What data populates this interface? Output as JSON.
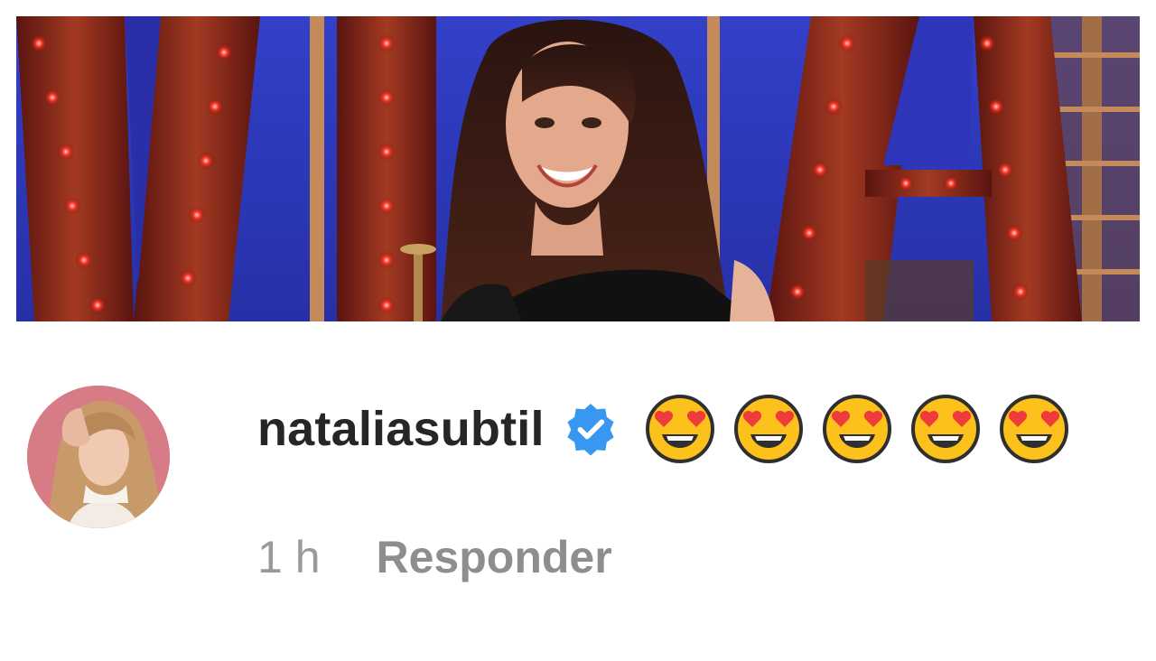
{
  "post_image": {
    "icon": "photo-woman-marquee-letters"
  },
  "comment": {
    "avatar_icon": "avatar-photo",
    "username": "nataliasubtil",
    "verified_icon": "verified-badge-icon",
    "emoji_text": [
      "😍",
      "😍",
      "😍",
      "😍",
      "😍"
    ],
    "time": "1 h",
    "reply_label": "Responder"
  },
  "colors": {
    "username": "#262626",
    "meta": "#8e8e8e",
    "verified": "#3897f0"
  }
}
